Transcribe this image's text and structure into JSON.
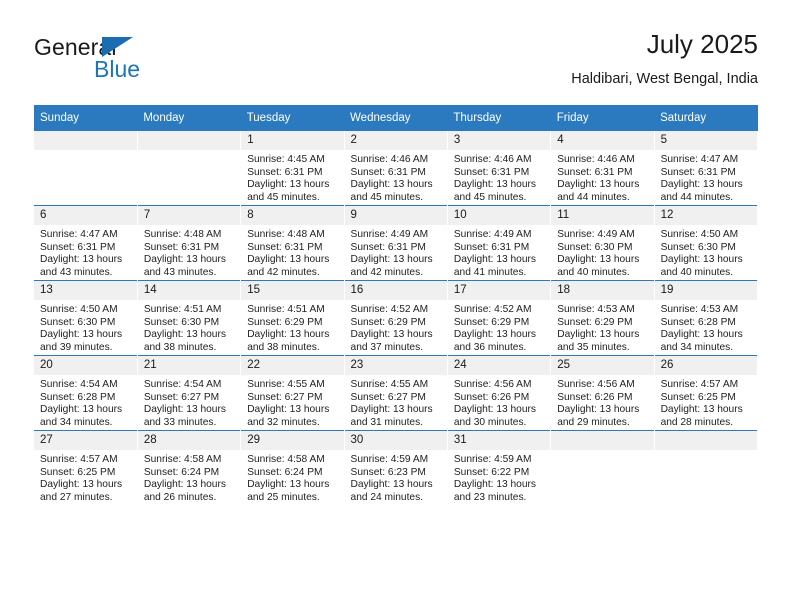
{
  "brand": {
    "name_part1": "General",
    "name_part2": "Blue",
    "triangle_color": "#1b6cb0",
    "blue_color": "#1b75bb"
  },
  "header": {
    "title": "July 2025",
    "subtitle": "Haldibari, West Bengal, India"
  },
  "colors": {
    "header_bar": "#2b7ac0",
    "daynum_bg": "#f0f0f0",
    "text": "#222222"
  },
  "weekdays": [
    "Sunday",
    "Monday",
    "Tuesday",
    "Wednesday",
    "Thursday",
    "Friday",
    "Saturday"
  ],
  "weeks": [
    [
      {
        "day": "",
        "blank": true,
        "sunrise": "",
        "sunset": "",
        "daylight1": "",
        "daylight2": ""
      },
      {
        "day": "",
        "blank": true,
        "sunrise": "",
        "sunset": "",
        "daylight1": "",
        "daylight2": ""
      },
      {
        "day": "1",
        "blank": false,
        "sunrise": "Sunrise: 4:45 AM",
        "sunset": "Sunset: 6:31 PM",
        "daylight1": "Daylight: 13 hours",
        "daylight2": "and 45 minutes."
      },
      {
        "day": "2",
        "blank": false,
        "sunrise": "Sunrise: 4:46 AM",
        "sunset": "Sunset: 6:31 PM",
        "daylight1": "Daylight: 13 hours",
        "daylight2": "and 45 minutes."
      },
      {
        "day": "3",
        "blank": false,
        "sunrise": "Sunrise: 4:46 AM",
        "sunset": "Sunset: 6:31 PM",
        "daylight1": "Daylight: 13 hours",
        "daylight2": "and 45 minutes."
      },
      {
        "day": "4",
        "blank": false,
        "sunrise": "Sunrise: 4:46 AM",
        "sunset": "Sunset: 6:31 PM",
        "daylight1": "Daylight: 13 hours",
        "daylight2": "and 44 minutes."
      },
      {
        "day": "5",
        "blank": false,
        "sunrise": "Sunrise: 4:47 AM",
        "sunset": "Sunset: 6:31 PM",
        "daylight1": "Daylight: 13 hours",
        "daylight2": "and 44 minutes."
      }
    ],
    [
      {
        "day": "6",
        "blank": false,
        "sunrise": "Sunrise: 4:47 AM",
        "sunset": "Sunset: 6:31 PM",
        "daylight1": "Daylight: 13 hours",
        "daylight2": "and 43 minutes."
      },
      {
        "day": "7",
        "blank": false,
        "sunrise": "Sunrise: 4:48 AM",
        "sunset": "Sunset: 6:31 PM",
        "daylight1": "Daylight: 13 hours",
        "daylight2": "and 43 minutes."
      },
      {
        "day": "8",
        "blank": false,
        "sunrise": "Sunrise: 4:48 AM",
        "sunset": "Sunset: 6:31 PM",
        "daylight1": "Daylight: 13 hours",
        "daylight2": "and 42 minutes."
      },
      {
        "day": "9",
        "blank": false,
        "sunrise": "Sunrise: 4:49 AM",
        "sunset": "Sunset: 6:31 PM",
        "daylight1": "Daylight: 13 hours",
        "daylight2": "and 42 minutes."
      },
      {
        "day": "10",
        "blank": false,
        "sunrise": "Sunrise: 4:49 AM",
        "sunset": "Sunset: 6:31 PM",
        "daylight1": "Daylight: 13 hours",
        "daylight2": "and 41 minutes."
      },
      {
        "day": "11",
        "blank": false,
        "sunrise": "Sunrise: 4:49 AM",
        "sunset": "Sunset: 6:30 PM",
        "daylight1": "Daylight: 13 hours",
        "daylight2": "and 40 minutes."
      },
      {
        "day": "12",
        "blank": false,
        "sunrise": "Sunrise: 4:50 AM",
        "sunset": "Sunset: 6:30 PM",
        "daylight1": "Daylight: 13 hours",
        "daylight2": "and 40 minutes."
      }
    ],
    [
      {
        "day": "13",
        "blank": false,
        "sunrise": "Sunrise: 4:50 AM",
        "sunset": "Sunset: 6:30 PM",
        "daylight1": "Daylight: 13 hours",
        "daylight2": "and 39 minutes."
      },
      {
        "day": "14",
        "blank": false,
        "sunrise": "Sunrise: 4:51 AM",
        "sunset": "Sunset: 6:30 PM",
        "daylight1": "Daylight: 13 hours",
        "daylight2": "and 38 minutes."
      },
      {
        "day": "15",
        "blank": false,
        "sunrise": "Sunrise: 4:51 AM",
        "sunset": "Sunset: 6:29 PM",
        "daylight1": "Daylight: 13 hours",
        "daylight2": "and 38 minutes."
      },
      {
        "day": "16",
        "blank": false,
        "sunrise": "Sunrise: 4:52 AM",
        "sunset": "Sunset: 6:29 PM",
        "daylight1": "Daylight: 13 hours",
        "daylight2": "and 37 minutes."
      },
      {
        "day": "17",
        "blank": false,
        "sunrise": "Sunrise: 4:52 AM",
        "sunset": "Sunset: 6:29 PM",
        "daylight1": "Daylight: 13 hours",
        "daylight2": "and 36 minutes."
      },
      {
        "day": "18",
        "blank": false,
        "sunrise": "Sunrise: 4:53 AM",
        "sunset": "Sunset: 6:29 PM",
        "daylight1": "Daylight: 13 hours",
        "daylight2": "and 35 minutes."
      },
      {
        "day": "19",
        "blank": false,
        "sunrise": "Sunrise: 4:53 AM",
        "sunset": "Sunset: 6:28 PM",
        "daylight1": "Daylight: 13 hours",
        "daylight2": "and 34 minutes."
      }
    ],
    [
      {
        "day": "20",
        "blank": false,
        "sunrise": "Sunrise: 4:54 AM",
        "sunset": "Sunset: 6:28 PM",
        "daylight1": "Daylight: 13 hours",
        "daylight2": "and 34 minutes."
      },
      {
        "day": "21",
        "blank": false,
        "sunrise": "Sunrise: 4:54 AM",
        "sunset": "Sunset: 6:27 PM",
        "daylight1": "Daylight: 13 hours",
        "daylight2": "and 33 minutes."
      },
      {
        "day": "22",
        "blank": false,
        "sunrise": "Sunrise: 4:55 AM",
        "sunset": "Sunset: 6:27 PM",
        "daylight1": "Daylight: 13 hours",
        "daylight2": "and 32 minutes."
      },
      {
        "day": "23",
        "blank": false,
        "sunrise": "Sunrise: 4:55 AM",
        "sunset": "Sunset: 6:27 PM",
        "daylight1": "Daylight: 13 hours",
        "daylight2": "and 31 minutes."
      },
      {
        "day": "24",
        "blank": false,
        "sunrise": "Sunrise: 4:56 AM",
        "sunset": "Sunset: 6:26 PM",
        "daylight1": "Daylight: 13 hours",
        "daylight2": "and 30 minutes."
      },
      {
        "day": "25",
        "blank": false,
        "sunrise": "Sunrise: 4:56 AM",
        "sunset": "Sunset: 6:26 PM",
        "daylight1": "Daylight: 13 hours",
        "daylight2": "and 29 minutes."
      },
      {
        "day": "26",
        "blank": false,
        "sunrise": "Sunrise: 4:57 AM",
        "sunset": "Sunset: 6:25 PM",
        "daylight1": "Daylight: 13 hours",
        "daylight2": "and 28 minutes."
      }
    ],
    [
      {
        "day": "27",
        "blank": false,
        "sunrise": "Sunrise: 4:57 AM",
        "sunset": "Sunset: 6:25 PM",
        "daylight1": "Daylight: 13 hours",
        "daylight2": "and 27 minutes."
      },
      {
        "day": "28",
        "blank": false,
        "sunrise": "Sunrise: 4:58 AM",
        "sunset": "Sunset: 6:24 PM",
        "daylight1": "Daylight: 13 hours",
        "daylight2": "and 26 minutes."
      },
      {
        "day": "29",
        "blank": false,
        "sunrise": "Sunrise: 4:58 AM",
        "sunset": "Sunset: 6:24 PM",
        "daylight1": "Daylight: 13 hours",
        "daylight2": "and 25 minutes."
      },
      {
        "day": "30",
        "blank": false,
        "sunrise": "Sunrise: 4:59 AM",
        "sunset": "Sunset: 6:23 PM",
        "daylight1": "Daylight: 13 hours",
        "daylight2": "and 24 minutes."
      },
      {
        "day": "31",
        "blank": false,
        "sunrise": "Sunrise: 4:59 AM",
        "sunset": "Sunset: 6:22 PM",
        "daylight1": "Daylight: 13 hours",
        "daylight2": "and 23 minutes."
      },
      {
        "day": "",
        "blank": true,
        "sunrise": "",
        "sunset": "",
        "daylight1": "",
        "daylight2": ""
      },
      {
        "day": "",
        "blank": true,
        "sunrise": "",
        "sunset": "",
        "daylight1": "",
        "daylight2": ""
      }
    ]
  ]
}
